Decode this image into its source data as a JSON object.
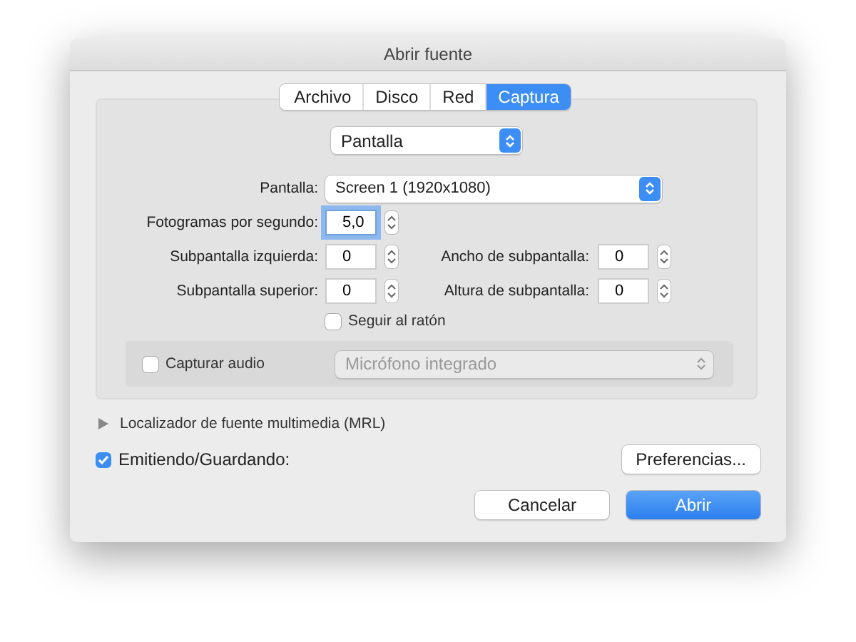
{
  "window": {
    "title": "Abrir fuente"
  },
  "tabs": [
    {
      "label": "Archivo",
      "selected": false
    },
    {
      "label": "Disco",
      "selected": false
    },
    {
      "label": "Red",
      "selected": false
    },
    {
      "label": "Captura",
      "selected": true
    }
  ],
  "source_select": {
    "value": "Pantalla"
  },
  "screen": {
    "label": "Pantalla:",
    "value": "Screen 1 (1920x1080)"
  },
  "fps": {
    "label": "Fotogramas por segundo:",
    "value": "5,0",
    "focused": true
  },
  "subscreen_rows": [
    {
      "left_label": "Subpantalla izquierda:",
      "left_value": "0",
      "right_label": "Ancho de subpantalla:",
      "right_value": "0"
    },
    {
      "left_label": "Subpantalla superior:",
      "left_value": "0",
      "right_label": "Altura de subpantalla:",
      "right_value": "0"
    }
  ],
  "follow_mouse": {
    "label": "Seguir al ratón",
    "checked": false
  },
  "audio": {
    "label": "Capturar audio",
    "checked": false,
    "device": "Micrófono integrado",
    "disabled": true
  },
  "mrl": {
    "label": "Localizador de fuente multimedia (MRL)",
    "expanded": false
  },
  "streaming": {
    "label": "Emitiendo/Guardando:",
    "checked": true
  },
  "buttons": [
    {
      "label": "Preferencias...",
      "kind": "preferences"
    },
    {
      "label": "Cancelar",
      "kind": "normal"
    },
    {
      "label": "Abrir",
      "kind": "default"
    }
  ]
}
